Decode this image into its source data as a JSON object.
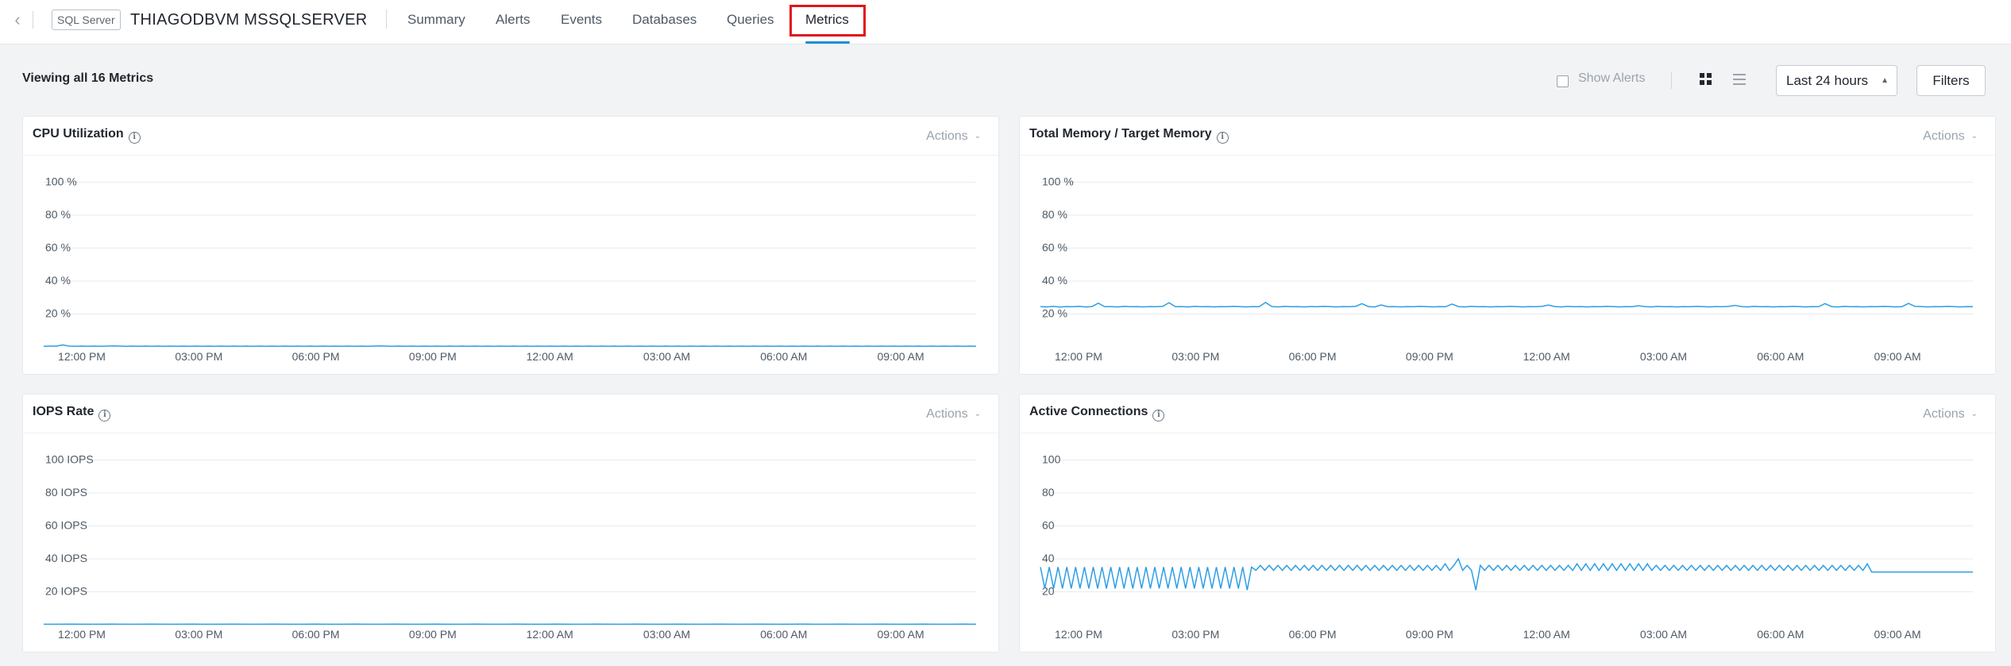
{
  "header": {
    "back_icon": "chevron-left-icon",
    "badge": "SQL Server",
    "host": "THIAGODBVM MSSQLSERVER",
    "tabs": [
      "Summary",
      "Alerts",
      "Events",
      "Databases",
      "Queries",
      "Metrics"
    ],
    "active_tab": "Metrics"
  },
  "toolbar": {
    "viewing": "Viewing all 16 Metrics",
    "show_alerts": "Show Alerts",
    "time_range": "Last 24 hours",
    "filters": "Filters",
    "grid_view_icon": "grid-view-icon",
    "list_view_icon": "list-view-icon"
  },
  "colors": {
    "accent": "#1b90d6",
    "highlight": "#e0141b",
    "line": "#2d9ee6"
  },
  "cards": [
    {
      "title": "CPU Utilization",
      "actions": "Actions",
      "chart_data": {
        "type": "line",
        "title": "CPU Utilization",
        "yticks": [
          "100 %",
          "80 %",
          "60 %",
          "40 %",
          "20 %"
        ],
        "xticks": [
          "12:00 PM",
          "03:00 PM",
          "06:00 PM",
          "09:00 PM",
          "12:00 AM",
          "03:00 AM",
          "06:00 AM",
          "09:00 AM"
        ],
        "ylim": [
          0,
          100
        ],
        "series": [
          {
            "values": [
              0.4,
              0.5,
              0.5,
              1.2,
              0.5,
              0.4,
              0.5,
              0.4,
              0.5,
              0.4,
              0.5,
              0.6,
              0.5,
              0.4,
              0.5,
              0.4,
              0.5,
              0.4,
              0.5,
              0.4,
              0.5,
              0.4,
              0.5,
              0.4,
              0.5,
              0.4,
              0.5,
              0.4,
              0.5,
              0.4,
              0.5,
              0.4,
              0.5,
              0.4,
              0.5,
              0.4,
              0.5,
              0.4,
              0.5,
              0.4,
              0.5,
              0.4,
              0.5,
              0.4,
              0.5,
              0.4,
              0.5,
              0.4,
              0.5,
              0.4,
              0.5,
              0.4,
              0.5,
              0.6,
              0.5,
              0.4,
              0.5,
              0.4,
              0.5,
              0.4,
              0.5,
              0.4,
              0.5,
              0.4,
              0.5,
              0.4,
              0.5,
              0.4,
              0.5,
              0.4,
              0.5,
              0.4,
              0.5,
              0.4,
              0.5,
              0.4,
              0.5,
              0.4,
              0.5,
              0.4,
              0.5,
              0.4,
              0.5,
              0.4,
              0.5,
              0.4,
              0.5,
              0.4,
              0.5,
              0.4,
              0.5,
              0.4,
              0.5,
              0.4,
              0.5,
              0.4,
              0.5,
              0.4,
              0.5,
              0.4,
              0.5,
              0.4,
              0.5,
              0.4,
              0.5,
              0.4,
              0.5,
              0.4,
              0.5,
              0.4,
              0.5,
              0.4,
              0.5,
              0.4,
              0.5,
              0.4,
              0.5,
              0.4,
              0.5,
              0.4,
              0.5,
              0.4,
              0.5,
              0.4,
              0.5,
              0.4,
              0.5,
              0.4,
              0.5,
              0.4,
              0.5,
              0.4,
              0.5,
              0.4,
              0.5,
              0.4,
              0.5,
              0.4,
              0.5,
              0.4,
              0.5,
              0.4,
              0.5,
              0.4,
              0.5,
              0.4,
              0.5,
              0.4
            ]
          }
        ]
      }
    },
    {
      "title": "Total Memory / Target Memory",
      "actions": "Actions",
      "chart_data": {
        "type": "line",
        "title": "Total Memory / Target Memory",
        "yticks": [
          "100 %",
          "80 %",
          "60 %",
          "40 %",
          "20 %"
        ],
        "xticks": [
          "12:00 PM",
          "03:00 PM",
          "06:00 PM",
          "09:00 PM",
          "12:00 AM",
          "03:00 AM",
          "06:00 AM",
          "09:00 AM"
        ],
        "ylim": [
          0,
          100
        ],
        "series": [
          {
            "values": [
              24.5,
              24.3,
              24.6,
              24.2,
              24.5,
              24.4,
              24.6,
              24.3,
              24.5,
              26.5,
              24.4,
              24.5,
              24.3,
              24.6,
              24.4,
              24.5,
              24.3,
              24.5,
              24.4,
              24.6,
              26.8,
              24.4,
              24.5,
              24.3,
              24.6,
              24.4,
              24.5,
              24.3,
              24.5,
              24.4,
              24.6,
              24.5,
              24.3,
              24.5,
              24.4,
              27.0,
              24.5,
              24.3,
              24.6,
              24.4,
              24.5,
              24.3,
              24.5,
              24.4,
              24.6,
              24.5,
              24.3,
              24.5,
              24.4,
              24.6,
              26.2,
              24.5,
              24.3,
              25.5,
              24.4,
              24.5,
              24.3,
              24.5,
              24.4,
              24.6,
              24.5,
              24.3,
              24.5,
              24.4,
              26.0,
              24.5,
              24.3,
              24.6,
              24.4,
              24.5,
              24.3,
              24.5,
              24.4,
              24.6,
              24.5,
              24.3,
              24.5,
              24.4,
              24.6,
              25.4,
              24.5,
              24.3,
              24.6,
              24.4,
              24.5,
              24.3,
              24.5,
              24.4,
              24.6,
              24.5,
              24.3,
              24.5,
              24.4,
              25.0,
              24.5,
              24.3,
              24.6,
              24.4,
              24.5,
              24.3,
              24.5,
              24.4,
              24.6,
              24.5,
              24.3,
              24.5,
              24.4,
              24.6,
              25.2,
              24.5,
              24.3,
              24.6,
              24.4,
              24.5,
              24.3,
              24.5,
              24.4,
              24.6,
              24.5,
              24.3,
              24.5,
              24.4,
              26.3,
              24.5,
              24.3,
              24.6,
              24.4,
              24.5,
              24.3,
              24.5,
              24.4,
              24.6,
              24.5,
              24.3,
              24.5,
              26.4,
              24.6,
              24.5,
              24.3,
              24.5,
              24.4,
              24.6,
              24.5,
              24.3,
              24.5,
              24.4
            ]
          }
        ]
      }
    },
    {
      "title": "IOPS Rate",
      "actions": "Actions",
      "chart_data": {
        "type": "line",
        "title": "IOPS Rate",
        "yticks": [
          "100 IOPS",
          "80 IOPS",
          "60 IOPS",
          "40 IOPS",
          "20 IOPS"
        ],
        "xticks": [
          "12:00 PM",
          "03:00 PM",
          "06:00 PM",
          "09:00 PM",
          "12:00 AM",
          "03:00 AM",
          "06:00 AM",
          "09:00 AM"
        ],
        "ylim": [
          0,
          100
        ],
        "series": [
          {
            "values": [
              0.3,
              0.3,
              0.4,
              0.3,
              0.3,
              0.4,
              0.3,
              0.3,
              0.4,
              0.3,
              0.3,
              0.4,
              0.3,
              0.3,
              0.4,
              0.3,
              0.3,
              0.4,
              0.3,
              0.3,
              0.4,
              0.3,
              0.3,
              0.4,
              0.3,
              0.3,
              0.4,
              0.3,
              0.3,
              0.4,
              0.3,
              0.3,
              0.4,
              0.3,
              0.3,
              0.4,
              0.3,
              0.3,
              0.4,
              0.3,
              0.3,
              0.4,
              0.3,
              0.3,
              0.4,
              0.3,
              0.3,
              0.4,
              0.3,
              0.3,
              0.4,
              0.3,
              0.3,
              0.4,
              0.3,
              0.3,
              0.4,
              0.3,
              0.3,
              0.4,
              0.3,
              0.3,
              0.4,
              0.3,
              0.3,
              0.4,
              0.3,
              0.3,
              0.4,
              0.3
            ]
          }
        ]
      }
    },
    {
      "title": "Active Connections",
      "actions": "Actions",
      "chart_data": {
        "type": "line",
        "title": "Active Connections",
        "yticks": [
          "100",
          "80",
          "60",
          "40",
          "20"
        ],
        "xticks": [
          "12:00 PM",
          "03:00 PM",
          "06:00 PM",
          "09:00 PM",
          "12:00 AM",
          "03:00 AM",
          "06:00 AM",
          "09:00 AM"
        ],
        "ylim": [
          0,
          100
        ],
        "series": [
          {
            "values": [
              35,
              22,
              35,
              22,
              35,
              22,
              35,
              22,
              35,
              22,
              35,
              22,
              35,
              22,
              35,
              22,
              35,
              22,
              35,
              22,
              35,
              22,
              35,
              22,
              35,
              22,
              35,
              22,
              35,
              22,
              35,
              22,
              35,
              22,
              35,
              22,
              35,
              22,
              35,
              22,
              35,
              22,
              35,
              22,
              35,
              22,
              35,
              21,
              35,
              33,
              36,
              33,
              36,
              33,
              36,
              33,
              36,
              33,
              36,
              33,
              36,
              33,
              36,
              33,
              36,
              33,
              36,
              33,
              36,
              33,
              36,
              33,
              36,
              33,
              36,
              33,
              36,
              33,
              36,
              33,
              36,
              33,
              36,
              33,
              36,
              33,
              36,
              33,
              36,
              33,
              36,
              33,
              37,
              33,
              36,
              40,
              33,
              36,
              33,
              21,
              36,
              33,
              36,
              33,
              36,
              33,
              36,
              33,
              36,
              33,
              36,
              33,
              36,
              33,
              36,
              33,
              36,
              33,
              36,
              33,
              36,
              33,
              37,
              33,
              37,
              33,
              37,
              33,
              37,
              33,
              37,
              33,
              37,
              33,
              37,
              33,
              37,
              33,
              37,
              33,
              36,
              33,
              36,
              33,
              36,
              33,
              36,
              33,
              36,
              33,
              36,
              33,
              36,
              33,
              36,
              33,
              36,
              33,
              36,
              33,
              36,
              33,
              36,
              33,
              36,
              33,
              36,
              33,
              36,
              33,
              36,
              33,
              36,
              33,
              36,
              33,
              36,
              33,
              36,
              33,
              36,
              33,
              36,
              33,
              36,
              33,
              36,
              33,
              37,
              32,
              32,
              32,
              32,
              32,
              32,
              32,
              32,
              32,
              32,
              32,
              32,
              32,
              32,
              32,
              32,
              32,
              32,
              32,
              32,
              32,
              32,
              32,
              32
            ]
          }
        ]
      }
    }
  ]
}
